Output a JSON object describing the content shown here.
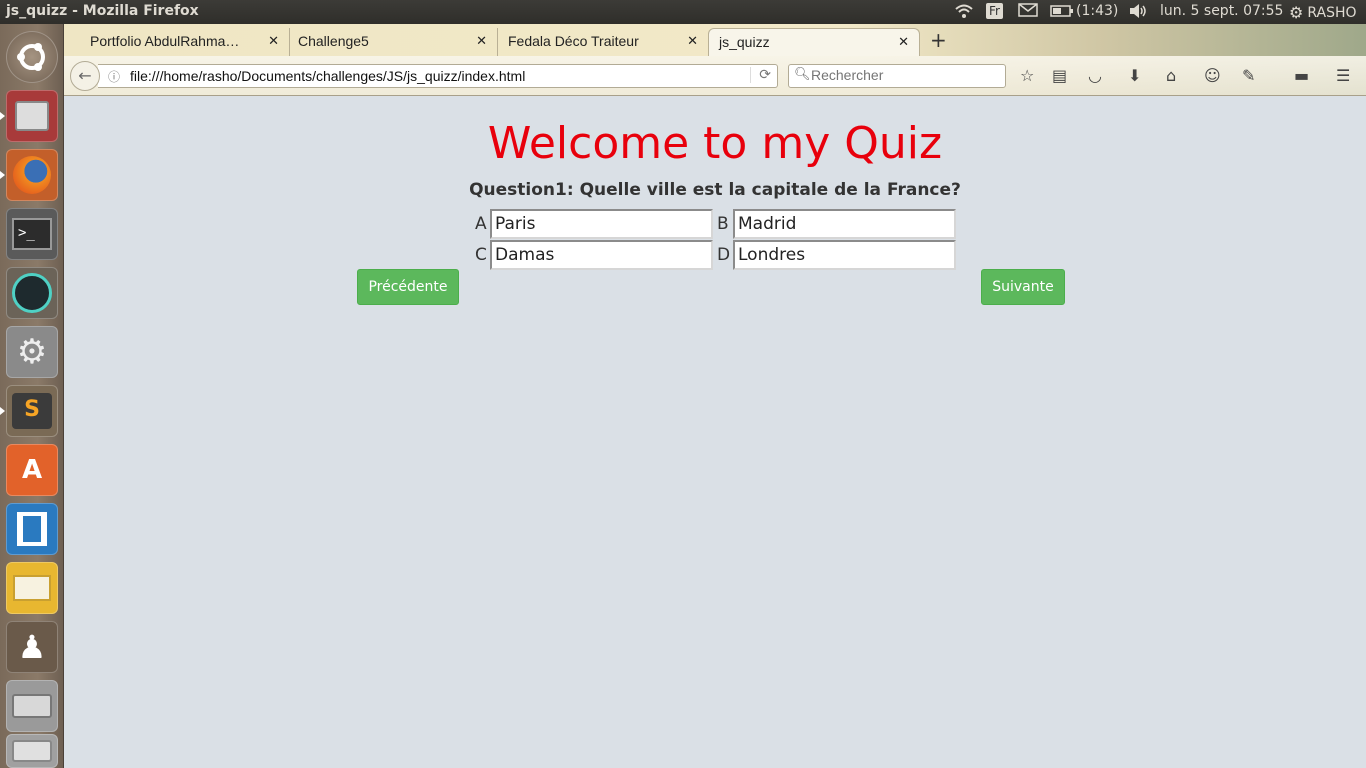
{
  "system": {
    "window_title": "js_quizz - Mozilla Firefox",
    "keyboard": "Fr",
    "battery": "(1:43)",
    "datetime": "lun.  5 sept. 07:55",
    "user": "RASHO"
  },
  "browser": {
    "tabs": [
      {
        "label": "Portfolio AbdulRahma…"
      },
      {
        "label": "Challenge5"
      },
      {
        "label": "Fedala Déco Traiteur"
      },
      {
        "label": "js_quizz"
      }
    ],
    "url": "file:///home/rasho/Documents/challenges/JS/js_quizz/index.html",
    "search_placeholder": "Rechercher"
  },
  "quiz": {
    "heading": "Welcome to my Quiz",
    "question": "Question1: Quelle ville est la capitale de la France?",
    "options": [
      {
        "letter": "A",
        "value": "Paris"
      },
      {
        "letter": "B",
        "value": "Madrid"
      },
      {
        "letter": "C",
        "value": "Damas"
      },
      {
        "letter": "D",
        "value": "Londres"
      }
    ],
    "prev_label": "Précédente",
    "next_label": "Suivante"
  },
  "colors": {
    "heading": "#e8000c",
    "button": "#5cb85c",
    "background": "#dae0e6"
  },
  "launcher_icons": [
    "ubuntu-dash-icon",
    "files-icon",
    "firefox-icon",
    "terminal-icon",
    "gitkraken-icon",
    "system-settings-icon",
    "sublime-text-icon",
    "software-center-icon",
    "brackets-icon",
    "mail-icon",
    "chess-icon",
    "drive-icon",
    "trash-icon"
  ]
}
